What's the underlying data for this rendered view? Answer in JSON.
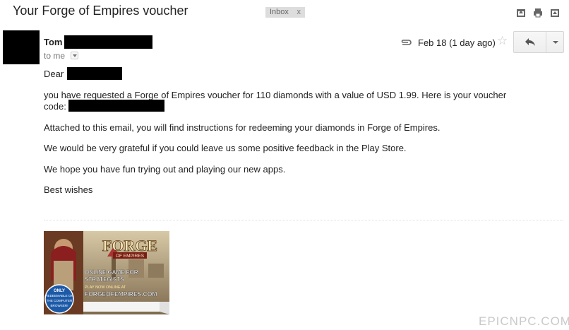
{
  "email": {
    "subject": "Your Forge of Empires voucher",
    "label": "Inbox",
    "label_close": "x",
    "sender_first_name": "Tom",
    "recipient_line": "to me",
    "date": "Feb 18 (1 day ago)",
    "greeting": "Dear",
    "body": {
      "line1": "you have requested a Forge of Empires voucher for 110 diamonds with a value of USD 1.99. Here is your voucher",
      "line2": "code:",
      "line3": "Attached to this email, you will find instructions for redeeming your diamonds in Forge of Empires.",
      "line4": "We would be very grateful if you could leave us some positive feedback in the Play Store.",
      "line5": "We hope you have fun trying out and playing our new apps.",
      "line6": "Best wishes"
    }
  },
  "banner": {
    "logo_top": "FORGE",
    "logo_sub": "OF EMPIRES",
    "tagline1": "ONLINE GAME FOR",
    "tagline2": "STRATEGISTS",
    "play_now": "PLAY NOW ONLINE AT",
    "url": "FORGEOFEMPIRES.COM",
    "badge1": "ONLY",
    "badge2": "REDEEMABLE ON",
    "badge3": "THE COMPUTER",
    "badge4": "BROWSER!"
  },
  "watermark": "EPICNPC.COM",
  "icons": [
    "archive-icon",
    "print-icon",
    "new-window-icon",
    "attachment-icon",
    "star-icon",
    "reply-icon",
    "more-options-icon",
    "to-me-details-icon"
  ],
  "colors": {
    "redaction": "#000000",
    "label_bg": "#dddddd",
    "banner_blue": "#1c5aa8"
  }
}
